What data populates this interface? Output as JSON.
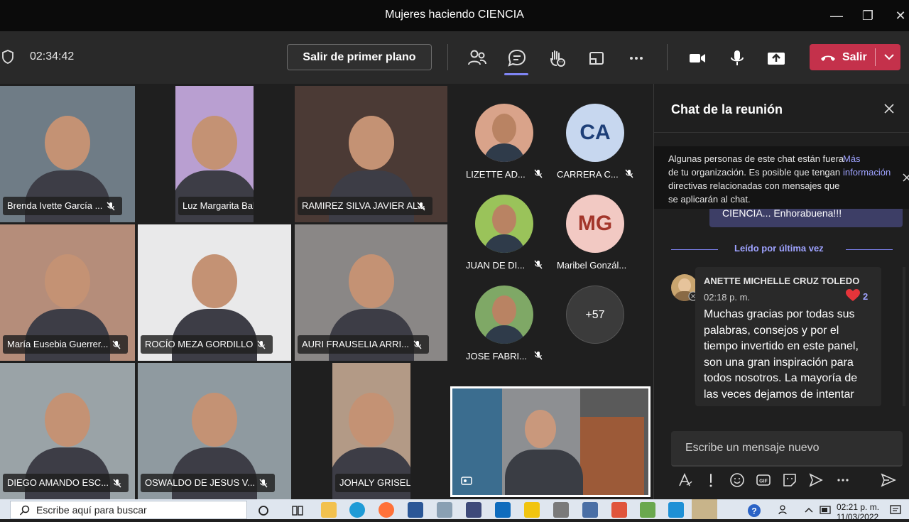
{
  "window": {
    "title": "Mujeres haciendo CIENCIA",
    "min": "—",
    "max": "❐",
    "close": "✕"
  },
  "toolbar": {
    "timer": "02:34:42",
    "exit_foreground": "Salir de primer plano",
    "leave": "Salir",
    "icons": [
      "participants-icon",
      "chat-icon",
      "raise-hand-icon",
      "share-tray-icon",
      "more-icon",
      "camera-icon",
      "mic-icon",
      "share-icon"
    ]
  },
  "tiles": [
    {
      "name": "Brenda Ivette García ...",
      "bg": "#6f7c86"
    },
    {
      "name": "Luz Margarita Balcazar...",
      "bg": "#b99fd1"
    },
    {
      "name": "RAMIREZ SILVA JAVIER AL...",
      "bg": "#4b3a35"
    },
    {
      "name": "María Eusebia Guerrer...",
      "bg": "#b58d7a"
    },
    {
      "name": "ROCÍO MEZA GORDILLO",
      "bg": "#e9e9ea"
    },
    {
      "name": "AURI FRAUSELIA ARRI...",
      "bg": "#8a8786"
    },
    {
      "name": "DIEGO AMANDO ESC...",
      "bg": "#9aa3a7"
    },
    {
      "name": "OSWALDO DE JESUS V...",
      "bg": "#8f9aa0"
    },
    {
      "name": "JOHALY GRISELL ESTR...",
      "bg": "#b39a86"
    }
  ],
  "roster": [
    {
      "name": "LIZETTE AD...",
      "initials": "",
      "bg": "#d9a38a"
    },
    {
      "name": "CARRERA C...",
      "initials": "CA",
      "bg": "#c7d7ef",
      "fg": "#1e3f78"
    },
    {
      "name": "JUAN DE DI...",
      "initials": "",
      "bg": "#9ac35a"
    },
    {
      "name": "Maribel Gonzál...",
      "initials": "MG",
      "bg": "#f2c9c3",
      "fg": "#a3352a"
    },
    {
      "name": "JOSE FABRI...",
      "initials": "",
      "bg": "#7fa866"
    },
    {
      "name": "",
      "initials": "+57",
      "bg": "#3b3b3b",
      "fg": "#ffffff"
    }
  ],
  "chat": {
    "title": "Chat de la reunión",
    "notice": "Algunas personas de este chat están fuera de tu organización. Es posible que tengan directivas relacionadas con mensajes que se aplicarán al chat.",
    "more_info": "Más información",
    "previous_snippet": "CIENCIA... Enhorabuena!!!",
    "read_marker": "Leído por última vez",
    "message": {
      "author": "ANETTE MICHELLE CRUZ TOLEDO",
      "time": "02:18 p. m.",
      "reaction_count": "2",
      "text": "Muchas gracias por todas sus palabras, consejos y por el tiempo invertido en este panel, son una gran inspiración para todos nosotros. La mayoría de las veces dejamos de intentar"
    },
    "compose_placeholder": "Escribe un mensaje nuevo"
  },
  "taskbar": {
    "search_placeholder": "Escribe aquí para buscar",
    "time": "02:21 p. m.",
    "date": "11/03/2022"
  },
  "colors": {
    "accent": "#7f85f5",
    "leave": "#c4314b",
    "reaction": "#e5343a"
  }
}
